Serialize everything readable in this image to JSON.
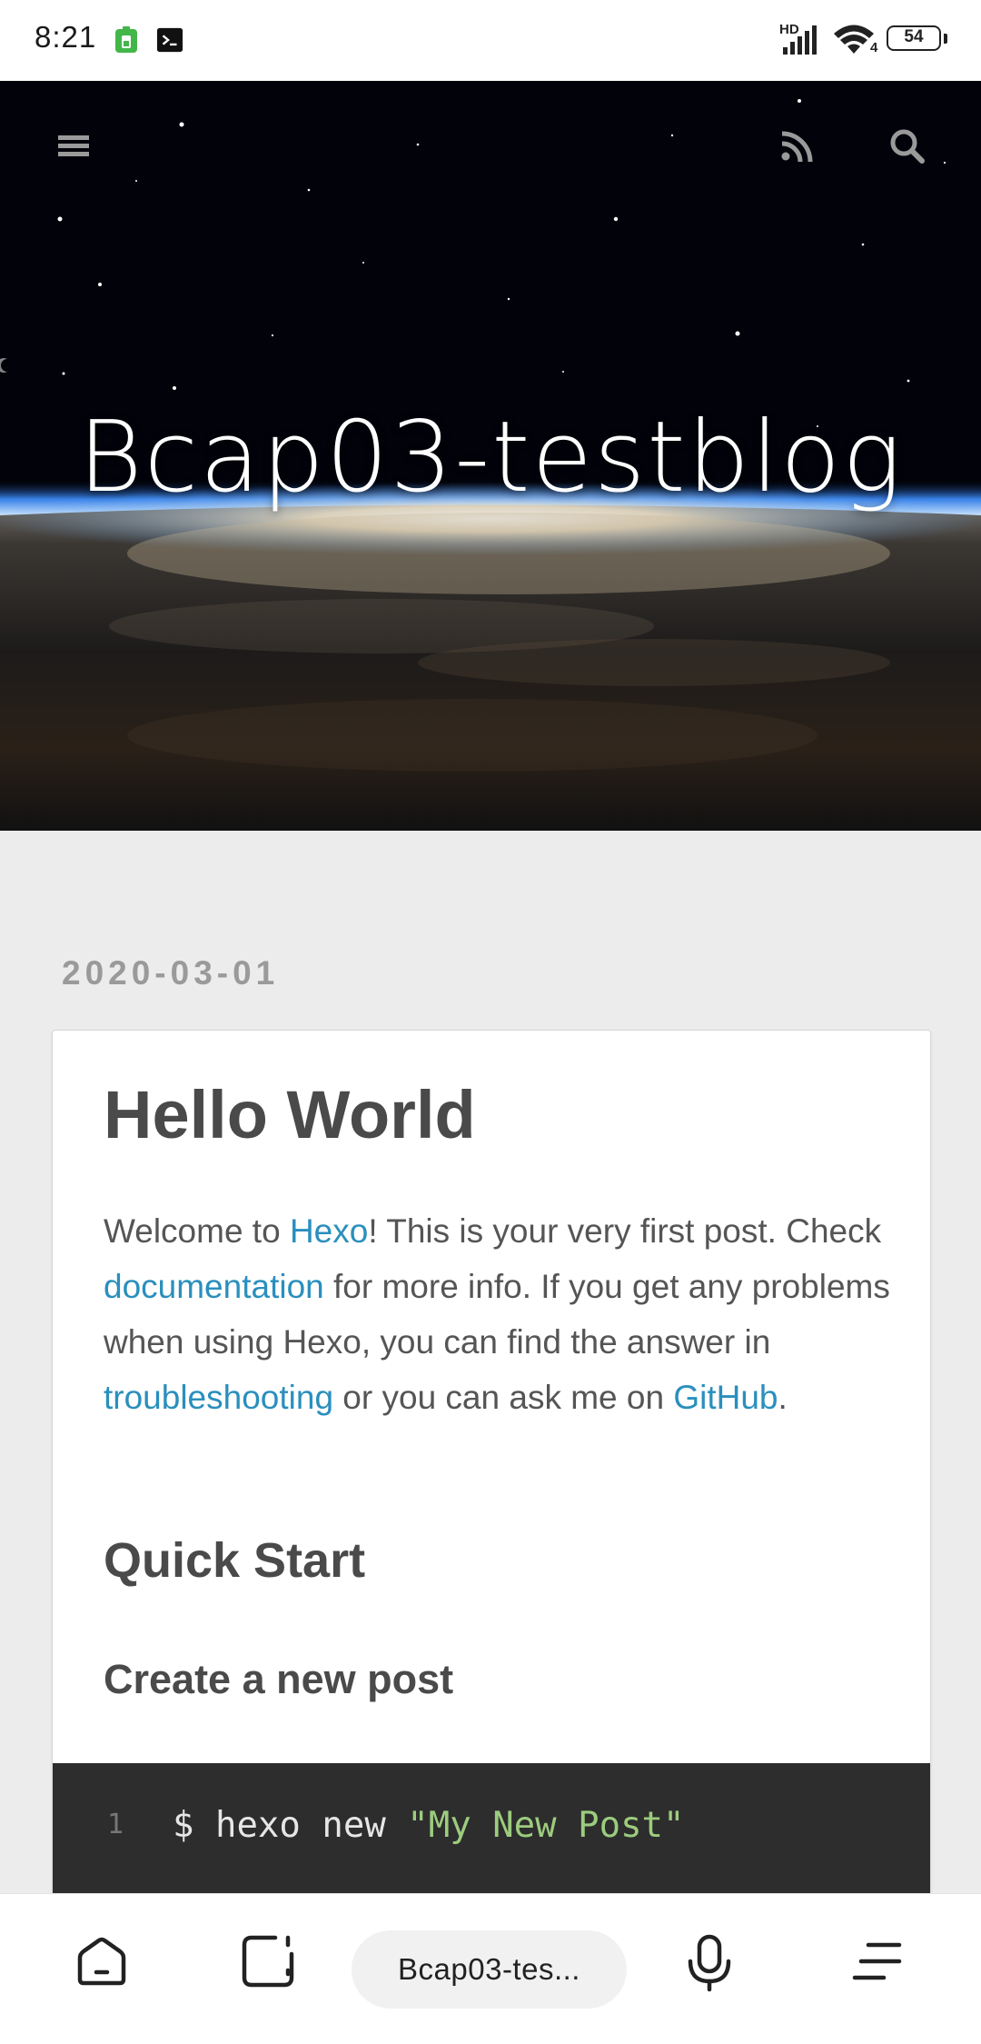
{
  "status_bar": {
    "time": "8:21",
    "network": "HD",
    "wifi_sub": "4",
    "battery": "54"
  },
  "hero": {
    "title": "Bcap03-testblog",
    "menu_icon": "menu-icon",
    "rss_icon": "rss-icon",
    "search_icon": "search-icon"
  },
  "post": {
    "date": "2020-03-01",
    "title": "Hello World",
    "intro": {
      "t1": "Welcome to ",
      "link_hexo": "Hexo",
      "t2": "! This is your very first post. Check ",
      "link_docs": "documentation",
      "t3": " for more info. If you get any problems when using Hexo, you can find the answer in ",
      "link_trouble": "troubleshooting",
      "t4": " or you can ask me on ",
      "link_github": "GitHub",
      "t5": "."
    },
    "h2": "Quick Start",
    "h3": "Create a new post",
    "code": {
      "line_no": "1",
      "prefix": "$ hexo new ",
      "string": "\"My New Post\""
    }
  },
  "browser_bar": {
    "url_label": "Bcap03-tes..."
  },
  "colors": {
    "link": "#2a8fbd",
    "text": "#555555",
    "heading": "#4a4a4a",
    "code_bg": "#2d2d2d",
    "code_string": "#9ccc7e"
  }
}
